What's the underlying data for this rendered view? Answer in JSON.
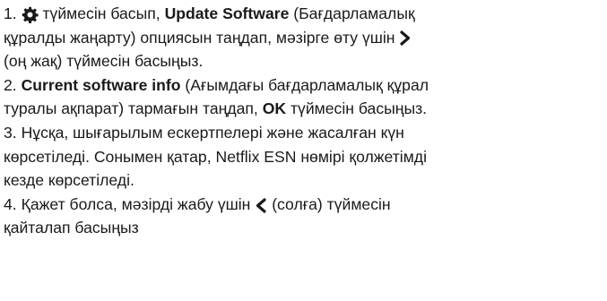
{
  "steps": [
    {
      "num": "1.",
      "pre": "түймесін басып,",
      "strong": "Update Software",
      "mid": "(Бағдарламалық",
      "line2_a": "құралды жаңарту) опциясын таңдап, мәзірге өту үшін",
      "line3": "(оң жақ) түймесін басыңыз."
    },
    {
      "num": "2.",
      "strong": "Current software info",
      "mid": "(Ағымдағы бағдарламалық құрал",
      "line2_a": "туралы ақпарат) тармағын таңдап,",
      "strong2": "OK",
      "line2_b": "түймесін басыңыз."
    },
    {
      "num": "3.",
      "line1": "Нұсқа, шығарылым ескертпелері және жасалған күн",
      "line2": "көрсетіледі. Сонымен қатар, Netflix ESN нөмірі қолжетімді",
      "line3": "кезде көрсетіледі."
    },
    {
      "num": "4.",
      "pre": "Қажет болса, мәзірді жабу үшін",
      "post": "(солға) түймесін",
      "line2": "қайталап басыңыз"
    }
  ],
  "icons": {
    "settings": "gear-icon",
    "right": "chevron-right-icon",
    "left": "chevron-left-icon"
  }
}
